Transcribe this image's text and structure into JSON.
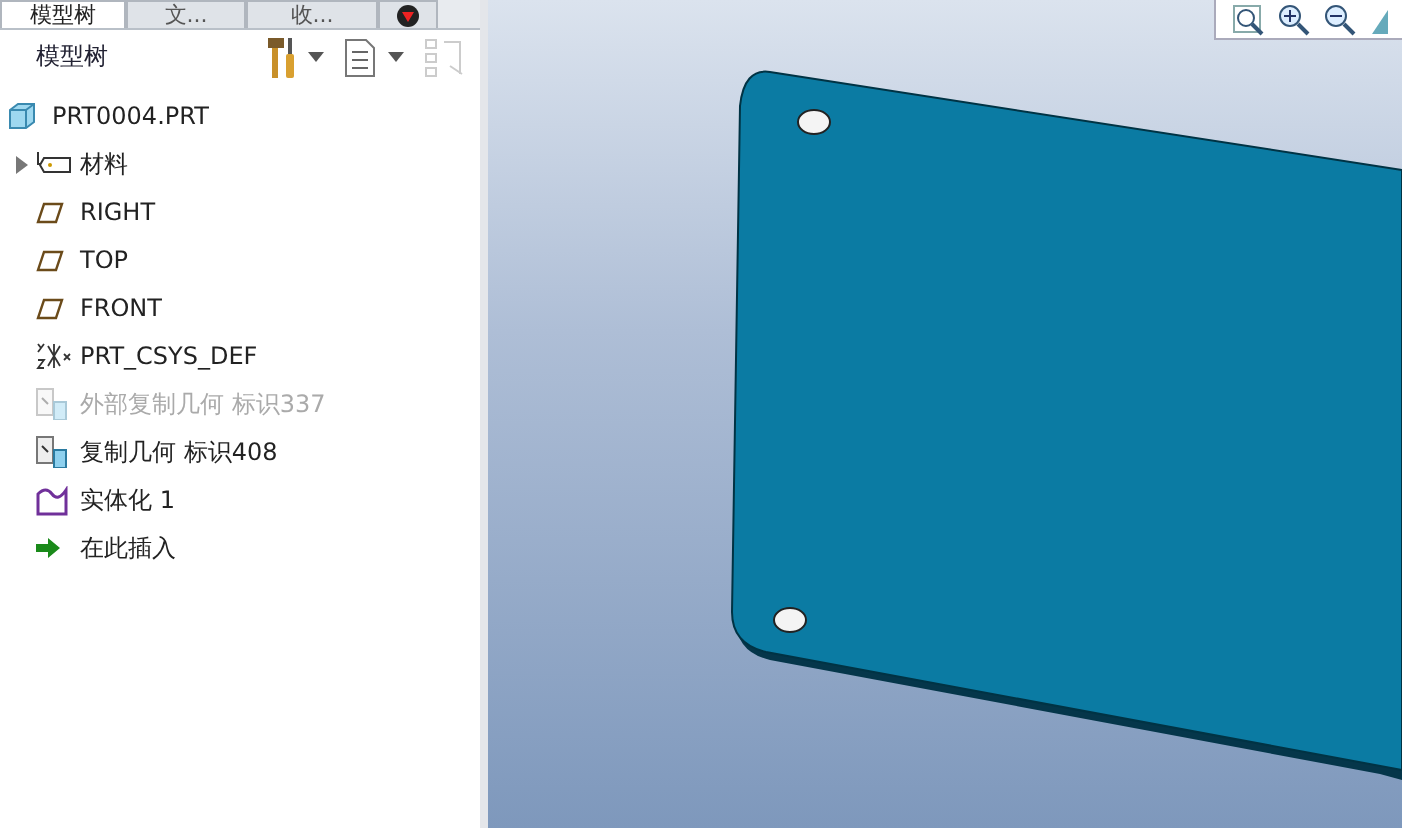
{
  "tabs": [
    {
      "kind": "text",
      "label": "模型树",
      "selected": true
    },
    {
      "kind": "text",
      "label": "文...",
      "selected": false
    },
    {
      "kind": "text",
      "label": "收...",
      "selected": false
    },
    {
      "kind": "icon",
      "selected": false
    }
  ],
  "tree_header": {
    "title": "模型树"
  },
  "tree": {
    "root": {
      "label": "PRT0004.PRT",
      "kind": "part"
    },
    "items": [
      {
        "label": "材料",
        "kind": "material",
        "expanded": false,
        "disabled": false
      },
      {
        "label": "RIGHT",
        "kind": "plane",
        "disabled": false
      },
      {
        "label": "TOP",
        "kind": "plane",
        "disabled": false
      },
      {
        "label": "FRONT",
        "kind": "plane",
        "disabled": false
      },
      {
        "label": "PRT_CSYS_DEF",
        "kind": "csys",
        "disabled": false
      },
      {
        "label": "外部复制几何 标识337",
        "kind": "copygeom",
        "disabled": true
      },
      {
        "label": "复制几何 标识408",
        "kind": "copygeom",
        "disabled": false
      },
      {
        "label": "实体化 1",
        "kind": "solidify",
        "disabled": false
      },
      {
        "label": "在此插入",
        "kind": "insert",
        "disabled": false
      }
    ]
  }
}
